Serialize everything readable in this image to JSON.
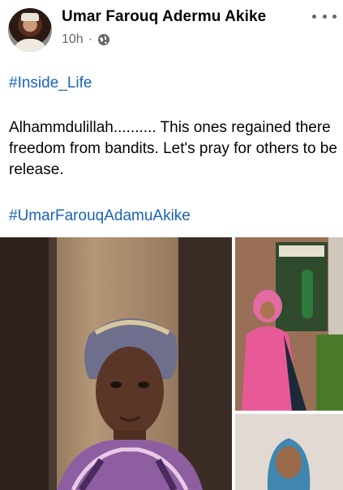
{
  "post": {
    "author": "Umar Farouq Adermu Akike",
    "time": "10h",
    "separator": "·",
    "audience_icon": "globe-icon",
    "more_icon": "more-options-icon",
    "hashtag_top": "#Inside_Life",
    "body": "Alhammdulillah.......... This ones regained there freedom from bandits. Let's pray for others to be release.",
    "hashtag_bottom": "#UmarFarouqAdamuAkike"
  },
  "colors": {
    "hashtag": "#1a62b8",
    "meta": "#65676b",
    "text": "#050505"
  }
}
